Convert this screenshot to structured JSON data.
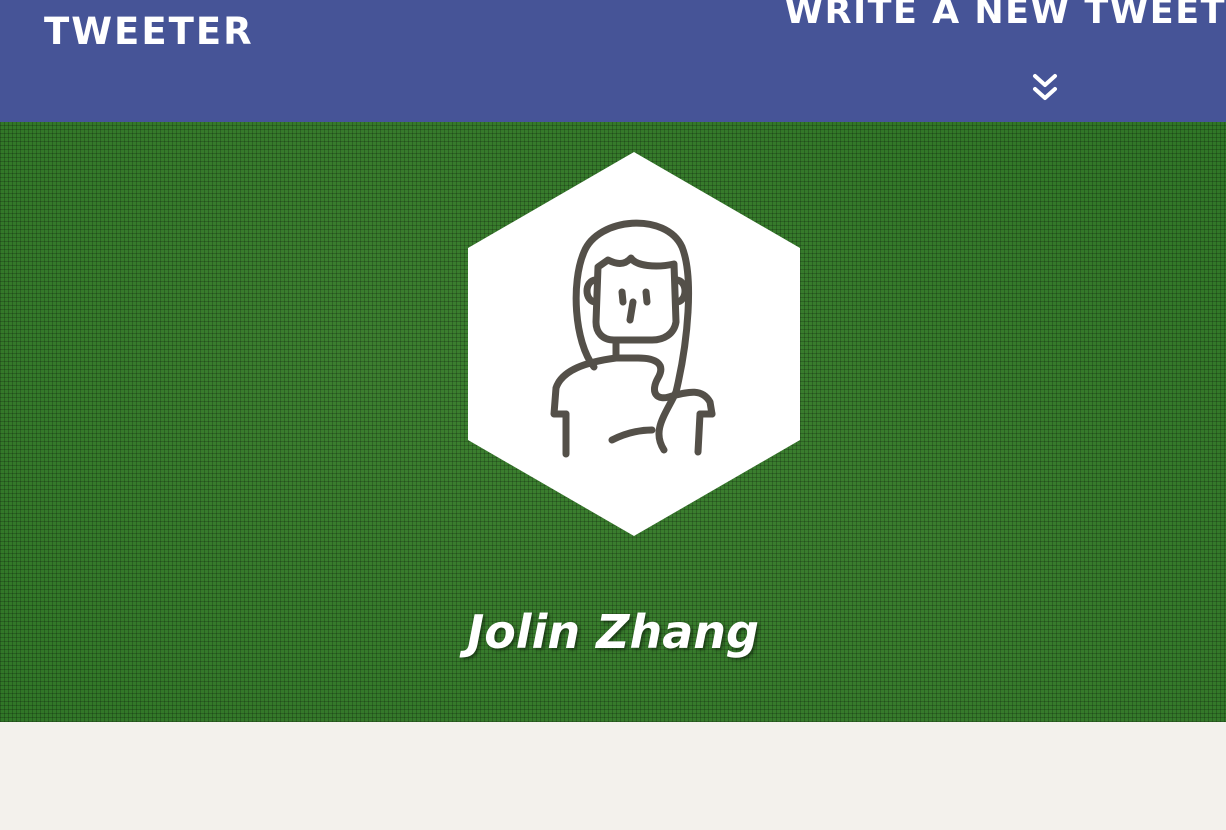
{
  "nav": {
    "brand": "Tweeter",
    "compose_label": "Write a new tweet",
    "compose_icon": "double-chevron-down-icon"
  },
  "profile": {
    "name": "Jolin Zhang",
    "avatar_icon": "woman-avatar-icon"
  },
  "colors": {
    "nav_background": "#465497",
    "hero_background": "#2f7526",
    "page_background": "#f3f1ec",
    "text": "#ffffff",
    "avatar_stroke": "#545049"
  }
}
